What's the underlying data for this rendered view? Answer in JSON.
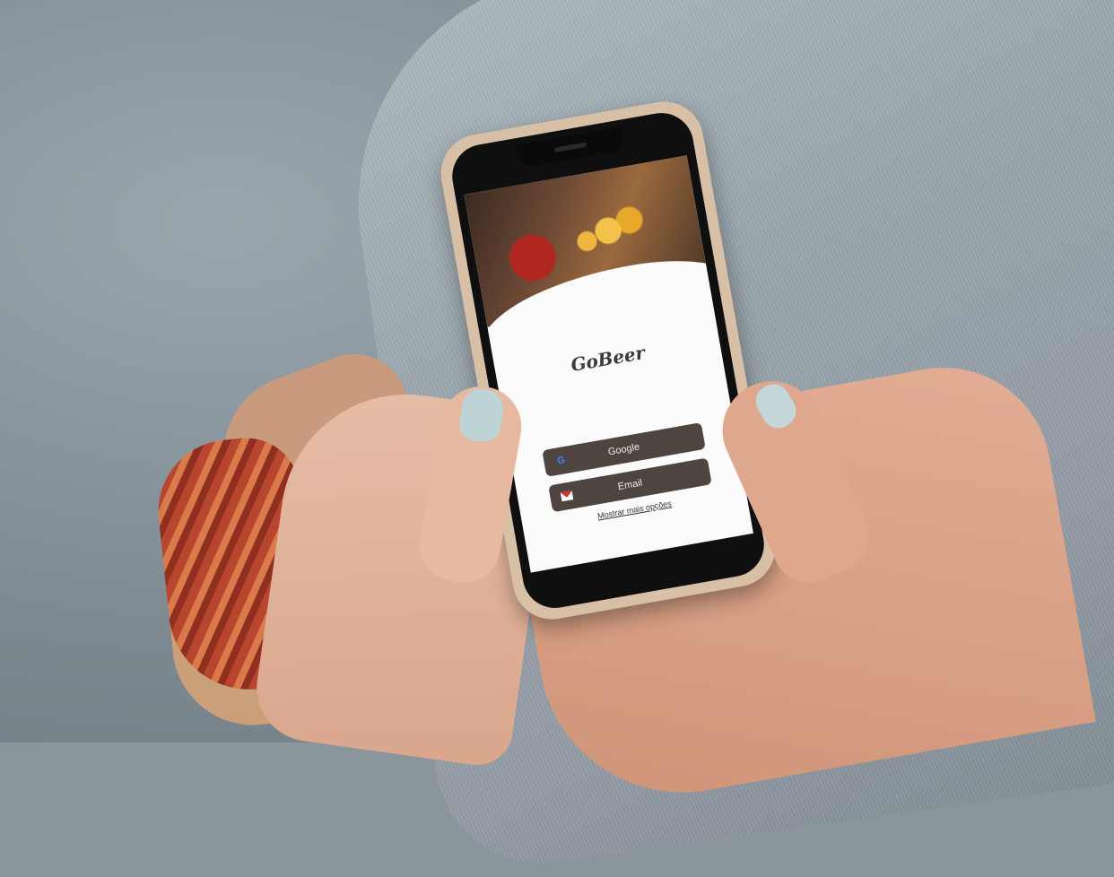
{
  "app": {
    "logo_text": "GoBeer"
  },
  "login": {
    "google_label": "Google",
    "email_label": "Email",
    "more_options_label": "Mostrar mais opções"
  },
  "icons": {
    "google": "google-icon",
    "email": "mail-icon"
  },
  "colors": {
    "button_bg": "#4e4541",
    "button_text": "#f0ecea",
    "screen_bg": "#fbfbfb",
    "logo_color": "#3e3a38"
  }
}
